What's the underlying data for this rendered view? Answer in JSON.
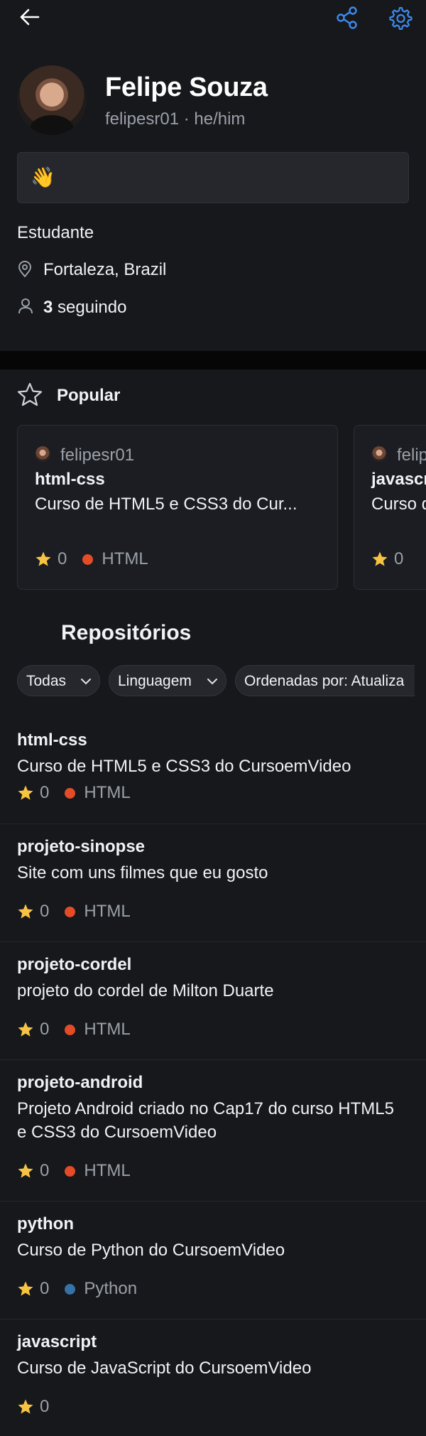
{
  "header": {
    "back_icon": "arrow-left-icon",
    "share_icon": "share-icon",
    "settings_icon": "gear-icon",
    "accent_color": "#3b8cf0"
  },
  "profile": {
    "name": "Felipe Souza",
    "handle_line": "felipesr01 · he/him",
    "bio_status": "👋",
    "occupation": "Estudante",
    "location": "Fortaleza, Brazil",
    "following_count": "3",
    "following_label": " seguindo"
  },
  "popular": {
    "heading": "Popular",
    "cards": [
      {
        "owner": "felipesr01",
        "name": "html-css",
        "description": "Curso de HTML5 e CSS3 do Cur...",
        "stars": "0",
        "language": "HTML",
        "language_color": "#e34c26"
      },
      {
        "owner": "felip",
        "name": "javascr",
        "description": "Curso d",
        "stars": "0"
      }
    ]
  },
  "repositories": {
    "heading": "Repositórios",
    "filters": [
      "Todas",
      "Linguagem",
      "Ordenadas por: Atualiza"
    ],
    "items": [
      {
        "name": "html-css",
        "description": "Curso de HTML5 e CSS3 do CursoemVideo",
        "stars": "0",
        "language": "HTML",
        "language_color": "#e34c26"
      },
      {
        "name": "projeto-sinopse",
        "description": "Site com uns filmes que eu gosto",
        "stars": "0",
        "language": "HTML",
        "language_color": "#e34c26"
      },
      {
        "name": "projeto-cordel",
        "description": "projeto do cordel de Milton Duarte",
        "stars": "0",
        "language": "HTML",
        "language_color": "#e34c26"
      },
      {
        "name": "projeto-android",
        "description": "Projeto Android criado no Cap17 do curso HTML5 e CSS3 do CursoemVideo",
        "stars": "0",
        "language": "HTML",
        "language_color": "#e34c26"
      },
      {
        "name": "python",
        "description": "Curso de Python do CursoemVideo",
        "stars": "0",
        "language": "Python",
        "language_color": "#3572a5"
      },
      {
        "name": "javascript",
        "description": "Curso de JavaScript do CursoemVideo",
        "stars": "0"
      }
    ]
  }
}
